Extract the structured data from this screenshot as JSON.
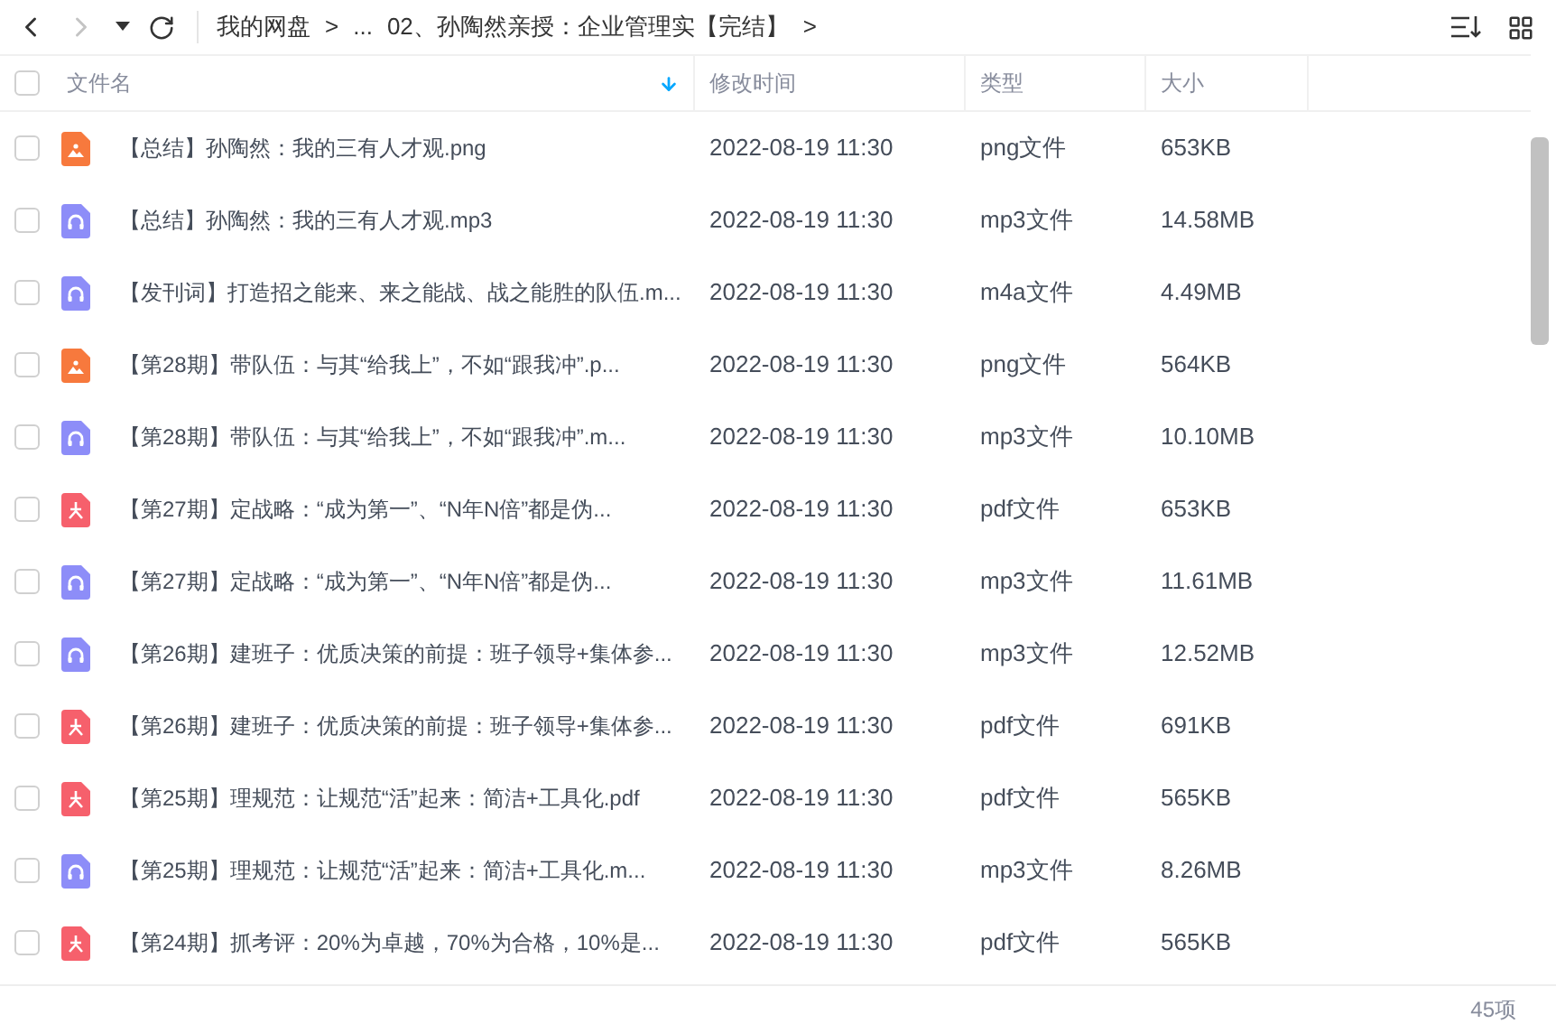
{
  "toolbar": {
    "back_disabled": false,
    "forward_disabled": true,
    "breadcrumb": [
      "我的网盘",
      ">",
      "...",
      "02、孙陶然亲授：企业管理实【完结】",
      ">"
    ]
  },
  "table": {
    "select_all": {
      "checked": false
    },
    "columns": [
      {
        "label": "文件名",
        "sorted": true
      },
      {
        "label": "修改时间",
        "sorted": false
      },
      {
        "label": "类型",
        "sorted": false
      },
      {
        "label": "大小",
        "sorted": false
      }
    ],
    "rows": [
      {
        "kind": "image",
        "checked": false,
        "name": "【总结】孙陶然：我的三有人才观.png",
        "modified": "2022-08-19 11:30",
        "type": "png文件",
        "size": "653KB"
      },
      {
        "kind": "audio",
        "checked": false,
        "name": "【总结】孙陶然：我的三有人才观.mp3",
        "modified": "2022-08-19 11:30",
        "type": "mp3文件",
        "size": "14.58MB"
      },
      {
        "kind": "audio",
        "checked": false,
        "name": "【发刊词】打造招之能来、来之能战、战之能胜的队伍.m...",
        "modified": "2022-08-19 11:30",
        "type": "m4a文件",
        "size": "4.49MB"
      },
      {
        "kind": "image",
        "checked": false,
        "name": "【第28期】带队伍：与其“给我上”，不如“跟我冲”.p...",
        "modified": "2022-08-19 11:30",
        "type": "png文件",
        "size": "564KB"
      },
      {
        "kind": "audio",
        "checked": false,
        "name": "【第28期】带队伍：与其“给我上”，不如“跟我冲”.m...",
        "modified": "2022-08-19 11:30",
        "type": "mp3文件",
        "size": "10.10MB"
      },
      {
        "kind": "pdf",
        "checked": false,
        "name": "【第27期】定战略：“成为第一”、“N年N倍”都是伪...",
        "modified": "2022-08-19 11:30",
        "type": "pdf文件",
        "size": "653KB"
      },
      {
        "kind": "audio",
        "checked": false,
        "name": "【第27期】定战略：“成为第一”、“N年N倍”都是伪...",
        "modified": "2022-08-19 11:30",
        "type": "mp3文件",
        "size": "11.61MB"
      },
      {
        "kind": "audio",
        "checked": false,
        "name": "【第26期】建班子：优质决策的前提：班子领导+集体参...",
        "modified": "2022-08-19 11:30",
        "type": "mp3文件",
        "size": "12.52MB"
      },
      {
        "kind": "pdf",
        "checked": false,
        "name": "【第26期】建班子：优质决策的前提：班子领导+集体参...",
        "modified": "2022-08-19 11:30",
        "type": "pdf文件",
        "size": "691KB"
      },
      {
        "kind": "pdf",
        "checked": false,
        "name": "【第25期】理规范：让规范“活”起来：简洁+工具化.pdf",
        "modified": "2022-08-19 11:30",
        "type": "pdf文件",
        "size": "565KB"
      },
      {
        "kind": "audio",
        "checked": false,
        "name": "【第25期】理规范：让规范“活”起来：简洁+工具化.m...",
        "modified": "2022-08-19 11:30",
        "type": "mp3文件",
        "size": "8.26MB"
      },
      {
        "kind": "pdf",
        "checked": false,
        "name": "【第24期】抓考评：20%为卓越，70%为合格，10%是...",
        "modified": "2022-08-19 11:30",
        "type": "pdf文件",
        "size": "565KB"
      }
    ]
  },
  "status_bar": {
    "count": "45项"
  }
}
